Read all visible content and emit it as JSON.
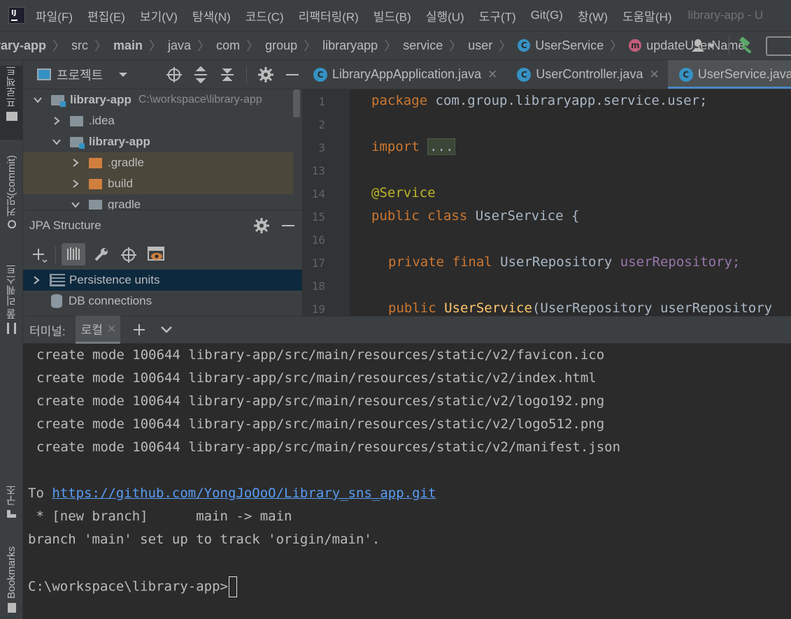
{
  "menubar": {
    "items": [
      "파일(F)",
      "편집(E)",
      "보기(V)",
      "탐색(N)",
      "코드(C)",
      "리팩터링(R)",
      "빌드(B)",
      "실행(U)",
      "도구(T)",
      "Git(G)",
      "창(W)",
      "도움말(H)"
    ],
    "window_title": "library-app - U"
  },
  "breadcrumb": {
    "items": [
      "rary-app",
      "src",
      "main",
      "java",
      "com",
      "group",
      "libraryapp",
      "service",
      "user",
      "UserService",
      "updateUserName"
    ]
  },
  "project_panel": {
    "title": "프로젝트",
    "root_label": "library-app",
    "root_path": "C:\\workspace\\library-app",
    "rows": [
      ".idea",
      "library-app",
      ".gradle",
      "build",
      "gradle"
    ]
  },
  "jpa_panel": {
    "title": "JPA Structure",
    "rows": [
      "Persistence units",
      "DB connections"
    ]
  },
  "left_strip": {
    "tabs": [
      "프로젝트",
      "커밋(commit)",
      "풀 리퀘스트",
      "구조",
      "Bookmarks"
    ]
  },
  "editor": {
    "tabs": [
      "LibraryAppApplication.java",
      "UserController.java",
      "UserService.java"
    ],
    "active_tab": "UserService.java",
    "line_numbers": [
      "1",
      "2",
      "3",
      "13",
      "14",
      "15",
      "16",
      "17",
      "18",
      "19"
    ],
    "lines": {
      "l1_kw": "package",
      "l1_rest": " com.group.libraryapp.service.user;",
      "l3_kw": "import",
      "l3_fold": "...",
      "l14": "@Service",
      "l15_kw": "public class",
      "l15_rest": " UserService {",
      "l17_kw": "private final",
      "l17_type": " UserRepository ",
      "l17_field": "userRepository;",
      "l19_kw": "public",
      "l19_method": "UserService",
      "l19_rest": "(UserRepository userRepository"
    }
  },
  "terminal": {
    "label": "터미널:",
    "tab": "로컬",
    "lines": [
      "create mode 100644 library-app/src/main/resources/static/v2/favicon.ico",
      "create mode 100644 library-app/src/main/resources/static/v2/index.html",
      "create mode 100644 library-app/src/main/resources/static/v2/logo192.png",
      "create mode 100644 library-app/src/main/resources/static/v2/logo512.png",
      "create mode 100644 library-app/src/main/resources/static/v2/manifest.json"
    ],
    "to_prefix": "To ",
    "url": "https://github.com/YongJoOoO/Library_sns_app.git",
    "branch_line": " * [new branch]      main -> main",
    "track_line": "branch 'main' set up to track 'origin/main'.",
    "prompt": "C:\\workspace\\library-app>"
  },
  "colors": {
    "background": "#2b2b2b",
    "panel": "#3c3f41",
    "keyword": "#cc7832",
    "annotation": "#bbb529",
    "field": "#9876aa",
    "method": "#ffc66d",
    "link": "#589df6",
    "class_icon": "#3592c4",
    "method_icon": "#c25e7a",
    "build_icon": "#59a869"
  }
}
